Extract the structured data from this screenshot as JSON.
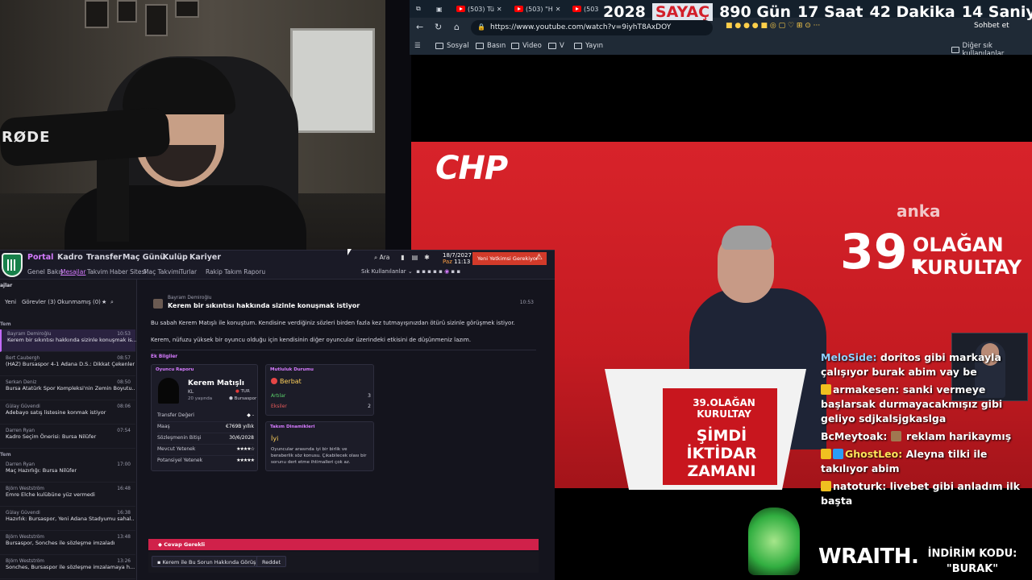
{
  "browser": {
    "tabs": [
      {
        "label": "(503) Tü"
      },
      {
        "label": "(503) \"H"
      },
      {
        "label": "(503"
      }
    ],
    "counter": {
      "year": "2028",
      "label": "SAYAÇ",
      "days": "890 Gün",
      "hours": "17 Saat",
      "minutes": "42 Dakika",
      "seconds": "14 Saniye"
    },
    "url": "https://www.youtube.com/watch?v=9iyhT8AxDOY",
    "chat_button": "Sohbet et",
    "bookmarks": [
      "Sosyal",
      "Basın",
      "Video",
      "V",
      "Yayın"
    ],
    "other_bookmarks": "Diğer sık kullanılanlar"
  },
  "webcam": {
    "mic_brand": "RØDE"
  },
  "video": {
    "banner_left": "CHP",
    "anka": "anka",
    "number": "39.",
    "event_line1": "OLAĞAN",
    "event_line2": "KURULTAY",
    "podium_top": "39.OLAĞAN KURULTAY",
    "podium_slogan_1": "ŞİMDİ",
    "podium_slogan_2": "İKTİDAR",
    "podium_slogan_3": "ZAMANI"
  },
  "chat": [
    {
      "user": "MeloSide:",
      "text": "doritos gibi markayla çalışıyor burak abim vay be",
      "user_color": "#8fd0ff"
    },
    {
      "user": "armakesen:",
      "text": "sanki vermeye başlarsak durmayacakmışız gibi geliyo sdjkalsjgkaslga",
      "user_color": "#ffffff"
    },
    {
      "user": "BcMeytoak:",
      "text": "reklam harikaymış",
      "user_color": "#ffffff"
    },
    {
      "user": "GhostLeo:",
      "text": "Aleyna tilki ile takılıyor abim",
      "user_color": "#ffe45a"
    },
    {
      "user": "natoturk:",
      "text": "livebet gibi anladım ilk başta",
      "user_color": "#ffffff"
    }
  ],
  "sponsor": {
    "brand": "WRAITH.",
    "promo_line1": "İNDİRİM KODU:",
    "promo_line2": "\"BURAK\""
  },
  "game": {
    "menu": [
      "Portal",
      "Kadro",
      "Transfer",
      "Maç Günü",
      "Kulüp",
      "Kariyer"
    ],
    "submenu": [
      "Genel Bakış",
      "Mesajlar",
      "Takvim",
      "Haber Sitesi",
      "Maç Takvimi",
      "Turlar",
      "Rakip Takım Raporu"
    ],
    "search_label": "Ara",
    "date_line1": "18/7/2027",
    "date_day": "Paz",
    "date_time": "11:13",
    "alert": "Yeni Yetkimsi Gerekiyor",
    "shortcuts_label": "Sık Kullanılanlar",
    "inbox_header": "ajlar",
    "inbox_tabs": [
      "Yeni",
      "Görevler (3)",
      "Okunmamış (0)"
    ],
    "section_1": "Tem",
    "section_2": "Tem",
    "inbox": [
      {
        "from": "Bayram Demiroğlu",
        "subject": "Kerem bir sıkıntısı hakkında sizinle konuşmak is...",
        "time": "10:53"
      },
      {
        "from": "Bert Caubergh",
        "subject": "(HAZ) Bursaspor 4-1 Adana D.S.: Dikkat Çekenler",
        "time": "08:57"
      },
      {
        "from": "Serkan Deniz",
        "subject": "Bursa Atatürk Spor Kompleksi'nin Zemin Boyutu...",
        "time": "08:50"
      },
      {
        "from": "Gülay Güvendi",
        "subject": "Adebayo satış listesine konmak istiyor",
        "time": "08:06"
      },
      {
        "from": "Darren Ryan",
        "subject": "Kadro Seçim Önerisi: Bursa Nilüfer",
        "time": "07:54"
      },
      {
        "from": "Darren Ryan",
        "subject": "Maç Hazırlığı: Bursa Nilüfer",
        "time": "17:00"
      },
      {
        "from": "Björn Westström",
        "subject": "Emre Elche kulübüne yüz vermedi",
        "time": "16:48"
      },
      {
        "from": "Gülay Güvendi",
        "subject": "Hazırlık: Bursaspor, Yeni Adana Stadyumu sahal...",
        "time": "16:38"
      },
      {
        "from": "Björn Westström",
        "subject": "Bursaspor, Sonches ile sözleşme imzaladı",
        "time": "13:48"
      },
      {
        "from": "Björn Westström",
        "subject": "Sonches, Bursaspor ile sözleşme imzalamaya h...",
        "time": "13:26"
      }
    ],
    "message": {
      "from": "Bayram Demiroğlu",
      "subject": "Kerem bir sıkıntısı hakkında sizinle konuşmak istiyor",
      "time": "10:53",
      "para1": "Bu sabah Kerem Matışlı ile konuştum. Kendisine verdiğiniz sözleri birden fazla kez tutmayışınızdan ötürü sizinle görüşmek istiyor.",
      "para2": "Kerem, nüfuzu yüksek bir oyuncu olduğu için kendisinin diğer oyuncular üzerindeki etkisini de düşünmeniz lazım.",
      "extra_label": "Ek Bilgiler"
    },
    "player": {
      "card_title": "Oyuncu Raporu",
      "name": "Kerem Matışlı",
      "position": "KL",
      "age": "20 yaşında",
      "nationality": "TUR",
      "club": "Bursaspor",
      "rows": [
        {
          "label": "Transfer Değeri",
          "value": "-"
        },
        {
          "label": "Maaş",
          "value": "€769B yıllık"
        },
        {
          "label": "Sözleşmenin Bitişi",
          "value": "30/6/2028"
        },
        {
          "label": "Mevcut Yetenek",
          "value": "★★★★☆"
        },
        {
          "label": "Potansiyel Yetenek",
          "value": "★★★★★"
        }
      ]
    },
    "morale": {
      "card_title": "Mutluluk Durumu",
      "value": "Berbat",
      "rows": [
        {
          "label": "Artılar",
          "value": "3",
          "color": "#5bd16b"
        },
        {
          "label": "Eksiler",
          "value": "2",
          "color": "#e85a5a"
        }
      ]
    },
    "team": {
      "card_title": "Takım Dinamikleri",
      "value": "İyi",
      "text": "Oyuncular arasında iyi bir birlik ve beraberlik söz konusu. Çıkabilecek olası bir sorunu dert etme ihtimalleri çok az."
    },
    "reply_required": "Cevap Gerekli",
    "reply_options": [
      "Kerem ile Bu Sorun Hakkında Görüş",
      "Reddet"
    ]
  }
}
